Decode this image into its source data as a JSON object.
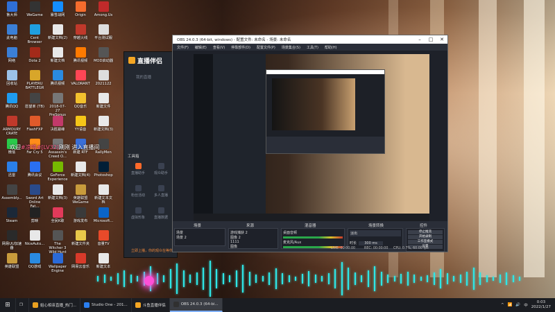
{
  "desktop": {
    "welcome_prefix": "欢迎",
    "welcome_name": "#凉嗒#",
    "welcome_level": "[LV32]",
    "welcome_suffix": "刚刚 进入直播间",
    "icons": [
      {
        "label": "鲁大师",
        "color": "#2f6fd8"
      },
      {
        "label": "WeGame",
        "color": "#333"
      },
      {
        "label": "暴雪战网",
        "color": "#148eff"
      },
      {
        "label": "Origin",
        "color": "#f56c2d"
      },
      {
        "label": "Among.Us",
        "color": "#c02a2a"
      },
      {
        "label": "此电脑",
        "color": "#3b7fd6"
      },
      {
        "label": "Cent Browser",
        "color": "#1f9fe0"
      },
      {
        "label": "新建文档(2)",
        "color": "#e8e8e8"
      },
      {
        "label": "穿越火线",
        "color": "#c0392b"
      },
      {
        "label": "平台测试服",
        "color": "#ddd"
      },
      {
        "label": "网络",
        "color": "#3b7fd6"
      },
      {
        "label": "Dota 2",
        "color": "#a32a1a"
      },
      {
        "label": "新建文档",
        "color": "#e8e8e8"
      },
      {
        "label": "腾讯视频",
        "color": "#ff7a00"
      },
      {
        "label": "MOD启动器",
        "color": "#555"
      },
      {
        "label": "回收站",
        "color": "#9cc2e8"
      },
      {
        "label": "PLAYERU BATTLEGR",
        "color": "#d8a62a"
      },
      {
        "label": "腾讯视频",
        "color": "#2a8ae0"
      },
      {
        "label": "VALORANT",
        "color": "#ff4655"
      },
      {
        "label": "2021122",
        "color": "#ddd"
      },
      {
        "label": "腾讯QQ",
        "color": "#1e9bf0"
      },
      {
        "label": "愿望单 (TB)",
        "color": "#444"
      },
      {
        "label": "2018-07-27 PreSonus",
        "color": "#777"
      },
      {
        "label": "QQ音乐",
        "color": "#f2c12e"
      },
      {
        "label": "新建文件",
        "color": "#e8e8e8"
      },
      {
        "label": "ARMOURY CRATE",
        "color": "#c0392b"
      },
      {
        "label": "FlashFXP",
        "color": "#e05a2a"
      },
      {
        "label": "决胜巅峰",
        "color": "#c23a6a"
      },
      {
        "label": "YY语音",
        "color": "#f5c518"
      },
      {
        "label": "新建文档(3)",
        "color": "#e8e8e8"
      },
      {
        "label": "微信",
        "color": "#2ac94a"
      },
      {
        "label": "Far Cry 5",
        "color": "#ff8c1a"
      },
      {
        "label": "Assassin's Creed O...",
        "color": "#777"
      },
      {
        "label": "新建 RTF",
        "color": "#3a6fd8"
      },
      {
        "label": "RallyMen",
        "color": "#444"
      },
      {
        "label": "迅雷",
        "color": "#2a7fe8"
      },
      {
        "label": "腾讯会议",
        "color": "#2a6ff0"
      },
      {
        "label": "GeForce Experience",
        "color": "#76b900"
      },
      {
        "label": "新建文档(4)",
        "color": "#e8e8e8"
      },
      {
        "label": "Photoshop",
        "color": "#001e36"
      },
      {
        "label": "Assembly...",
        "color": "#444"
      },
      {
        "label": "Sword Art Online Fat...",
        "color": "#2a4a8a"
      },
      {
        "label": "新建文档(3)",
        "color": "#e8e8e8"
      },
      {
        "label": "英雄联盟WeGame",
        "color": "#c89b3c"
      },
      {
        "label": "新建文本文档",
        "color": "#e8e8e8"
      },
      {
        "label": "Steam",
        "color": "#1b2838"
      },
      {
        "label": "剪映",
        "color": "#222"
      },
      {
        "label": "全民K歌",
        "color": "#e23a5a"
      },
      {
        "label": "游戏发布",
        "color": "#3a3a3a"
      },
      {
        "label": "Microsoft...",
        "color": "#0a64c8"
      },
      {
        "label": "网易UU加速器",
        "color": "#2a2a2a"
      },
      {
        "label": "NiceAuto...",
        "color": "#e8e8e8"
      },
      {
        "label": "The Witcher 3 Wild Hunt",
        "color": "#555"
      },
      {
        "label": "新建文件夹",
        "color": "#e8c84a"
      },
      {
        "label": "音量TV",
        "color": "#e84a2a"
      },
      {
        "label": "英雄联盟",
        "color": "#c89b3c"
      },
      {
        "label": "QQ游戏",
        "color": "#2a8ae0"
      },
      {
        "label": "Wallpaper Engine",
        "color": "#2a6ad8"
      },
      {
        "label": "网易云音乐",
        "color": "#d83a2a"
      },
      {
        "label": "新建文本",
        "color": "#e8e8e8"
      }
    ]
  },
  "streaming_app": {
    "brand": "直播伴侣",
    "tab": "我的直播",
    "nav": [
      {
        "label": "直播助手",
        "icon": "camera-icon"
      },
      {
        "label": "观众助手",
        "icon": "user-icon"
      },
      {
        "label": "粉丝活动",
        "icon": "star-icon"
      },
      {
        "label": "多人直播",
        "icon": "download-icon"
      },
      {
        "label": "虚拟形象",
        "icon": "mask-icon"
      },
      {
        "label": "直播数据",
        "icon": "chart-icon"
      }
    ],
    "tool_label": "工具箱",
    "bottom_text": "立即上播，你的观众在等你"
  },
  "obs": {
    "title": "OBS 24.0.3 (64-bit, windows) - 配置文件: 未命名 - 场景: 未命名",
    "menu": [
      "文件(F)",
      "编辑(E)",
      "查看(V)",
      "停靠部件(D)",
      "配置文件(P)",
      "场景集合(S)",
      "工具(T)",
      "帮助(H)"
    ],
    "panels": {
      "scenes": {
        "title": "场景",
        "items": [
          "场景",
          "场景 2"
        ]
      },
      "sources": {
        "title": "来源",
        "items": [
          "游戏捕获 2",
          "图像 2",
          "1111",
          "图像",
          "窗口捕获"
        ]
      },
      "mixer": {
        "title": "混音器",
        "channels": [
          {
            "name": "桌面音频",
            "level": "0.0 dB"
          },
          {
            "name": "麦克风/Aux",
            "level": "0.0 dB"
          }
        ]
      },
      "transitions": {
        "title": "场景转换",
        "type": "淡出",
        "duration_label": "时长",
        "duration": "300 ms"
      },
      "controls": {
        "title": "控件",
        "buttons": [
          "停止推流",
          "开始录制",
          "工作室模式",
          "设置",
          "退出"
        ]
      }
    },
    "status": {
      "drop": "LIVE: 00:00:00",
      "rec": "REC: 00:00:00",
      "cpu": "CPU: 0.7%, 60.00 fps"
    }
  },
  "taskbar": {
    "search_text": "姐心相亲直播_热门...",
    "items": [
      {
        "label": "姐心相亲直播_热门...",
        "color": "#e8a020"
      },
      {
        "label": "Studio One - 201...",
        "color": "#2a7ff0"
      },
      {
        "label": "斗鱼直播伴侣",
        "color": "#f5a623"
      },
      {
        "label": "OBS 24.0.3 (64-bi...",
        "color": "#303030"
      }
    ],
    "active_index": 3,
    "time": "0:03",
    "date": "2022/1/27"
  },
  "accent": {
    "wave": "#2ee6e6",
    "obs_bg": "#1e2129",
    "panel_bg": "#2a2e38"
  }
}
